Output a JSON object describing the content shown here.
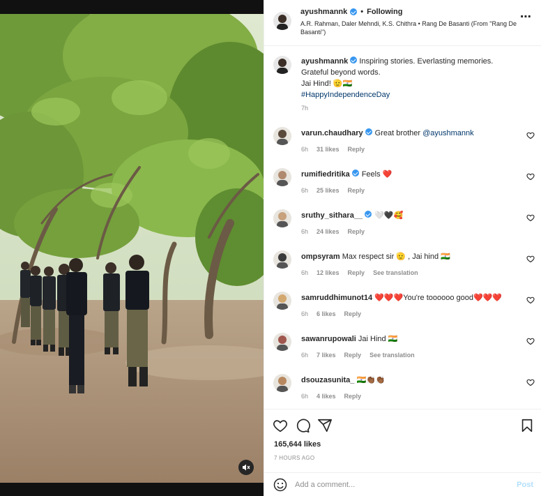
{
  "post": {
    "username": "ayushmannk",
    "follow_status": "Following",
    "audio": "A.R. Rahman, Daler Mehndi, K.S. Chithra • Rang De Basanti (From \"Rang De Basanti\")",
    "caption": {
      "line1": "Inspiring stories. Everlasting memories.",
      "line2": "Grateful beyond words.",
      "line3": "Jai Hind! 🫡🇮🇳",
      "hashtag": "#HappyIndependenceDay",
      "time": "7h"
    },
    "likes": "165,644 likes",
    "posted": "7 HOURS AGO"
  },
  "comments": [
    {
      "user": "varun.chaudhary",
      "verified": true,
      "text": "Great brother ",
      "mention": "@ayushmannk",
      "time": "6h",
      "likes": "31 likes",
      "reply": "Reply",
      "translate": ""
    },
    {
      "user": "rumifiedritika",
      "verified": true,
      "text": "Feels ❤️",
      "mention": "",
      "time": "6h",
      "likes": "25 likes",
      "reply": "Reply",
      "translate": ""
    },
    {
      "user": "sruthy_sithara__",
      "verified": true,
      "text": "🤍🖤🥰",
      "mention": "",
      "time": "6h",
      "likes": "24 likes",
      "reply": "Reply",
      "translate": ""
    },
    {
      "user": "ompsyram",
      "verified": false,
      "text": "Max respect sir 🫡 , Jai hind 🇮🇳",
      "mention": "",
      "time": "6h",
      "likes": "12 likes",
      "reply": "Reply",
      "translate": "See translation"
    },
    {
      "user": "samruddhimunot14",
      "verified": false,
      "text": "❤️❤️❤️You're toooooo good❤️❤️❤️",
      "mention": "",
      "time": "6h",
      "likes": "6 likes",
      "reply": "Reply",
      "translate": ""
    },
    {
      "user": "sawanrupowali",
      "verified": false,
      "text": "Jai Hind 🇮🇳",
      "mention": "",
      "time": "6h",
      "likes": "7 likes",
      "reply": "Reply",
      "translate": "See translation"
    },
    {
      "user": "dsouzasunita_",
      "verified": false,
      "text": "🇮🇳👏🏾👏🏾",
      "mention": "",
      "time": "6h",
      "likes": "4 likes",
      "reply": "Reply",
      "translate": ""
    }
  ],
  "composer": {
    "placeholder": "Add a comment...",
    "post_label": "Post"
  },
  "icons": {
    "like": "heart-icon",
    "comment": "comment-icon",
    "share": "share-icon",
    "save": "bookmark-icon",
    "emoji": "emoji-icon",
    "more": "more-icon",
    "mute": "mute-icon"
  },
  "colors": {
    "link": "#00376b",
    "verified": "#3897f0",
    "muted": "#8e8e8e",
    "heart_red": "#ed4956"
  }
}
